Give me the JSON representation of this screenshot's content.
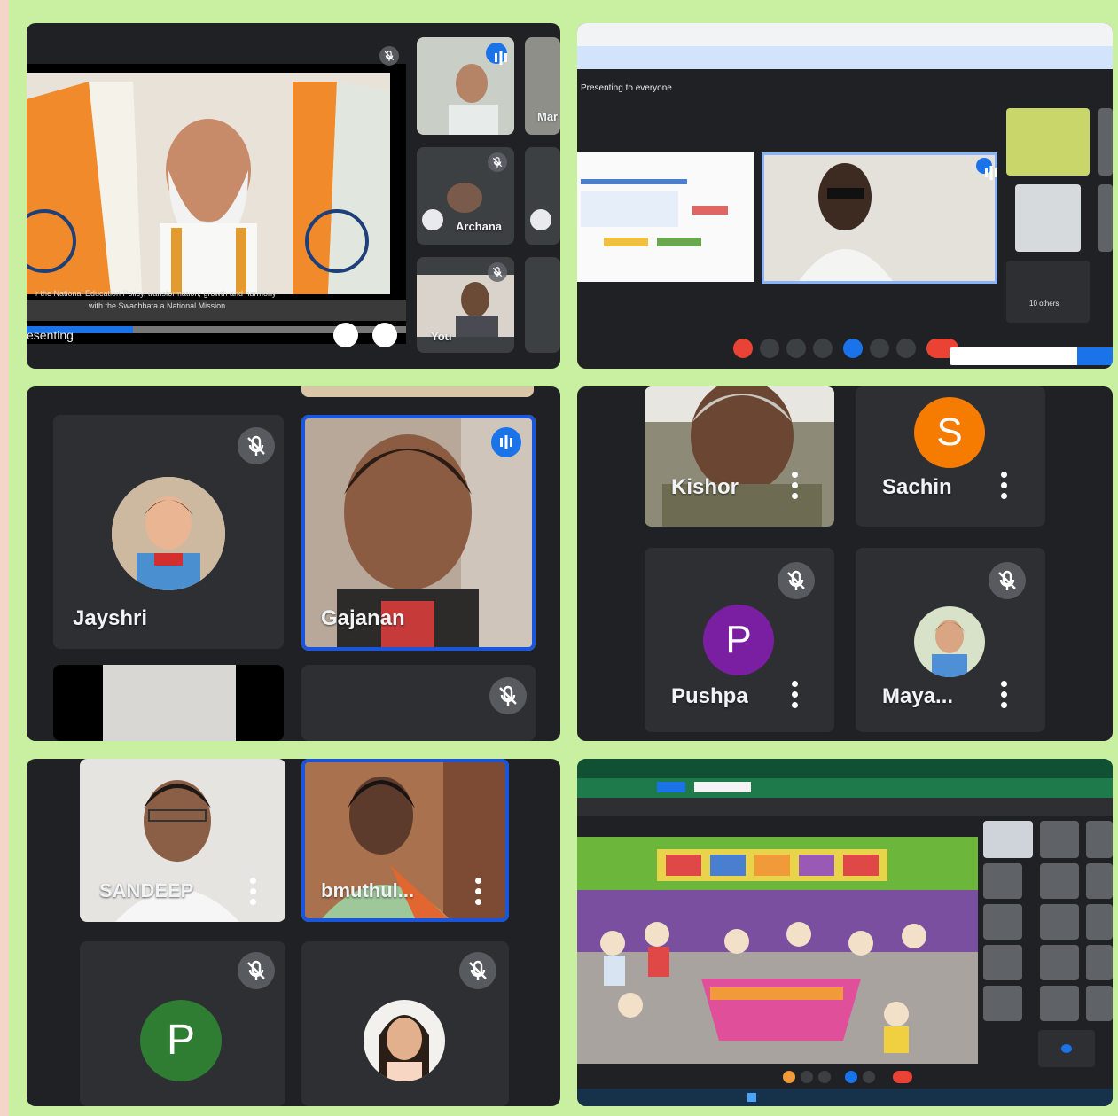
{
  "screens": {
    "top_left": {
      "participants": [
        "Archana",
        "Mar",
        "You"
      ],
      "presenting_label": "esenting",
      "caption": "r the National Education Policy, transformation, growth and harmony",
      "caption_line2": "with the Swachhata a National Mission"
    },
    "top_right": {
      "notice": "Presenting to everyone",
      "others_label": "10 others"
    },
    "middle_left": {
      "participants": [
        "Jayshri",
        "Gajanan"
      ]
    },
    "middle_right": {
      "participants": [
        "Kishor",
        "Sachin",
        "Pushpa",
        "Maya..."
      ],
      "avatar_letters": {
        "sachin": "S",
        "pushpa": "P"
      }
    },
    "bottom_left": {
      "participants": [
        "SANDEEP",
        "bmuthul..."
      ],
      "avatar_letter": "P"
    },
    "bottom_right": {}
  },
  "colors": {
    "frame": "#c8f0a0",
    "meet_bg": "#202124",
    "tile": "#3c4043",
    "accent_blue": "#1a73e8",
    "end_call_red": "#ea4335",
    "avatar_orange": "#f57c00",
    "avatar_purple": "#7b1fa2",
    "avatar_green": "#2e7d32"
  },
  "icons": [
    "mic-off-icon",
    "speaking-icon",
    "more-options-icon",
    "fullscreen-icon",
    "present-icon"
  ]
}
